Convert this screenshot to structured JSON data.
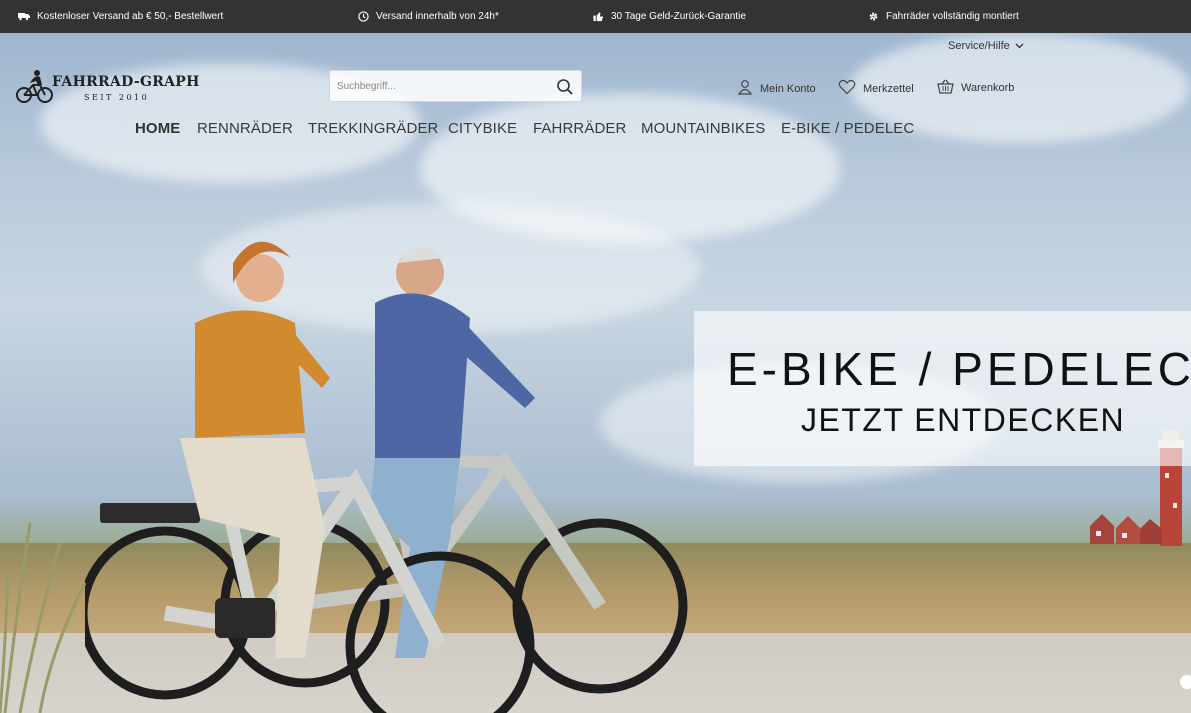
{
  "topbar": {
    "usps": [
      {
        "icon": "truck-icon",
        "text": "Kostenloser Versand ab € 50,- Bestellwert"
      },
      {
        "icon": "clock-icon",
        "text": "Versand innerhalb von 24h*"
      },
      {
        "icon": "thumbs-up-icon",
        "text": "30 Tage Geld-Zurück-Garantie"
      },
      {
        "icon": "gear-icon",
        "text": "Fahrräder vollständig montiert"
      }
    ]
  },
  "header": {
    "service_label": "Service/Hilfe",
    "logo_title": "FAHRRAD-GRAPH",
    "logo_subtitle": "SEIT 2010",
    "search_placeholder": "Suchbegriff...",
    "account_label": "Mein Konto",
    "wishlist_label": "Merkzettel",
    "cart_label": "Warenkorb"
  },
  "nav": {
    "items": [
      {
        "label": "HOME",
        "active": true
      },
      {
        "label": "RENNRÄDER",
        "active": false
      },
      {
        "label": "TREKKINGRÄDER",
        "active": false
      },
      {
        "label": "CITYBIKE",
        "active": false
      },
      {
        "label": "FAHRRÄDER",
        "active": false
      },
      {
        "label": "MOUNTAINBIKES",
        "active": false
      },
      {
        "label": "E-BIKE / PEDELEC",
        "active": false
      }
    ]
  },
  "banner": {
    "title": "E-BIKE / PEDELEC",
    "subtitle": "JETZT ENTDECKEN"
  },
  "colors": {
    "topbar_bg": "#333333",
    "text": "#333333"
  }
}
